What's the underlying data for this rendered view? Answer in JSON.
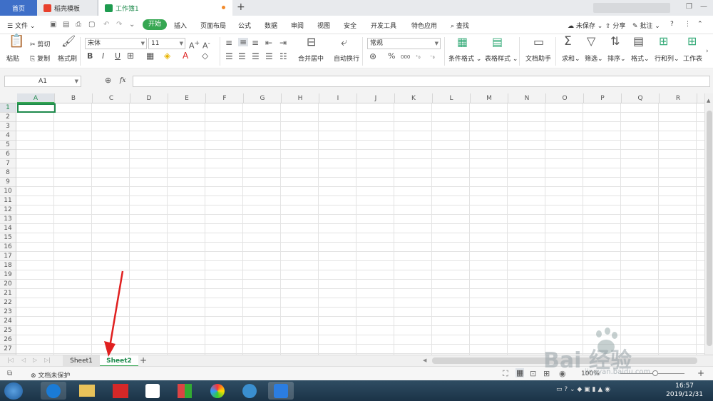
{
  "tabs": {
    "home": "首页",
    "templates": "稻壳模板",
    "workbook": "工作簿1"
  },
  "menu": {
    "file": "文件",
    "items": [
      "开始",
      "插入",
      "页面布局",
      "公式",
      "数据",
      "审阅",
      "视图",
      "安全",
      "开发工具",
      "特色应用"
    ],
    "search": "查找",
    "unsaved": "未保存",
    "share": "分享",
    "comment": "批注"
  },
  "ribbon": {
    "paste": "粘贴",
    "cut": "剪切",
    "copy": "复制",
    "format_painter": "格式刷",
    "font_name": "宋体",
    "font_size": "11",
    "bold": "B",
    "italic": "I",
    "underline": "U",
    "merge_center": "合并居中",
    "wrap_text": "自动换行",
    "number_format": "常规",
    "percent": "%",
    "thousands": "000",
    "cond_format": "条件格式",
    "table_style": "表格样式",
    "doc_assistant": "文档助手",
    "sum": "求和",
    "filter": "筛选",
    "sort": "排序",
    "format": "格式",
    "row_col": "行和列",
    "worksheet": "工作表"
  },
  "formula_bar": {
    "name_box": "A1",
    "fx": "fx",
    "value": ""
  },
  "columns": [
    "A",
    "B",
    "C",
    "D",
    "E",
    "F",
    "G",
    "H",
    "I",
    "J",
    "K",
    "L",
    "M",
    "N",
    "O",
    "P",
    "Q",
    "R"
  ],
  "rows": [
    "1",
    "2",
    "3",
    "4",
    "5",
    "6",
    "7",
    "8",
    "9",
    "10",
    "11",
    "12",
    "13",
    "14",
    "15",
    "16",
    "17",
    "18",
    "19",
    "20",
    "21",
    "22",
    "23",
    "24",
    "25",
    "26",
    "27"
  ],
  "sheets": [
    "Sheet1",
    "Sheet2"
  ],
  "active_sheet": "Sheet2",
  "status": {
    "protection": "文档未保护",
    "zoom": "100%"
  },
  "taskbar": {
    "time": "16:57",
    "date": "2019/12/31"
  },
  "watermark": {
    "brand": "Bai 经验",
    "url": "jingyan.baidu.com"
  },
  "colors": {
    "accent_green": "#36a752",
    "active_tab_blue": "#3e6fc8",
    "selection": "#1e8a4c",
    "annotation_red": "#e02020"
  }
}
